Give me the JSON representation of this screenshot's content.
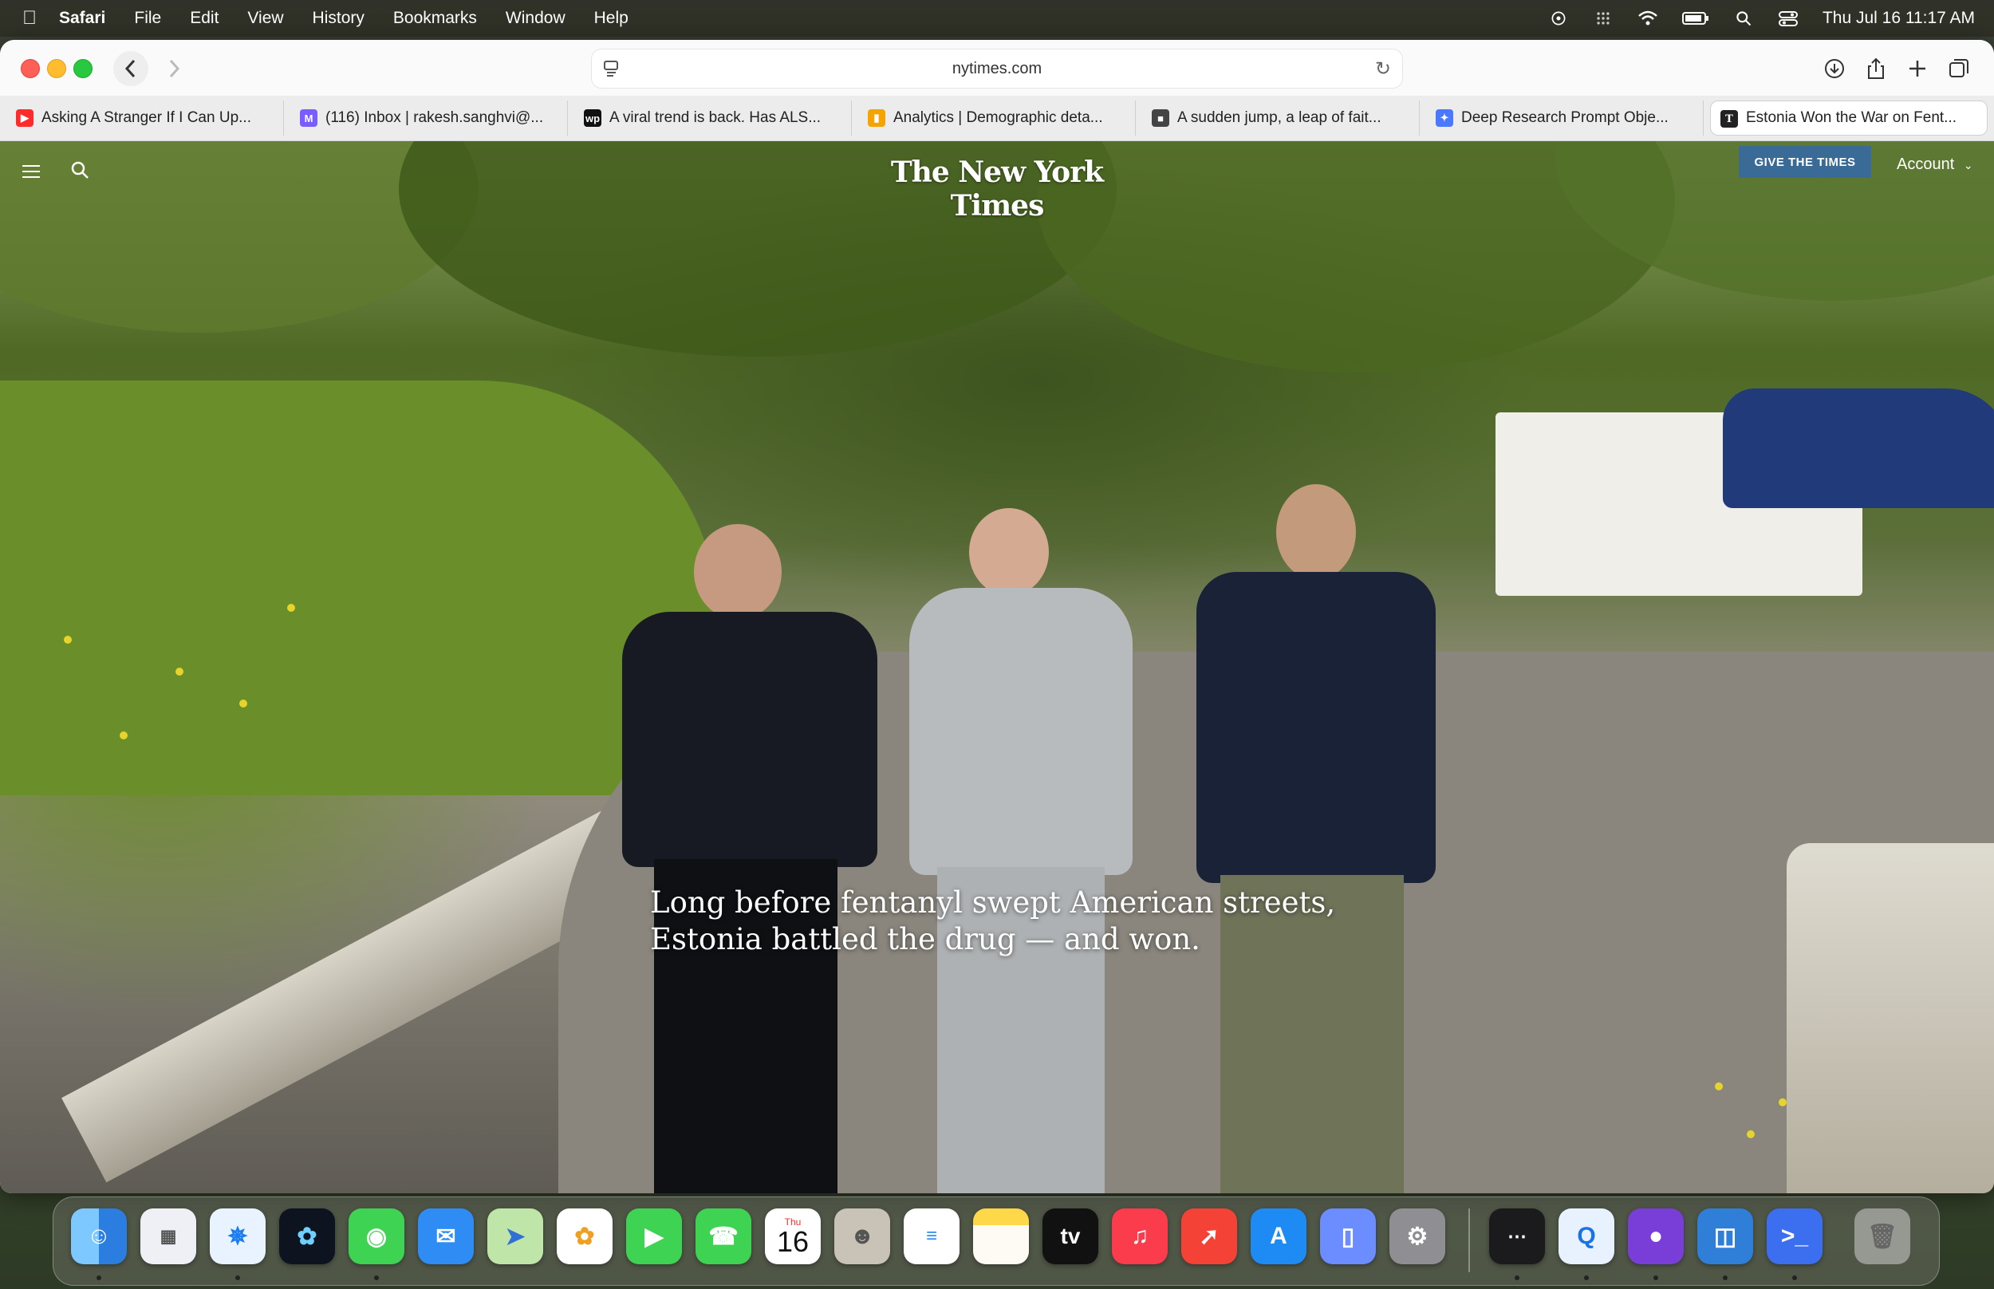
{
  "menubar": {
    "app": "Safari",
    "items": [
      "File",
      "Edit",
      "View",
      "History",
      "Bookmarks",
      "Window",
      "Help"
    ],
    "clock": "Thu Jul 16  11:17 AM"
  },
  "address": {
    "url": "nytimes.com"
  },
  "tabs": [
    {
      "title": "Asking A Stranger If I Can Up...",
      "fav_color": "#ff2b2b",
      "fav_glyph": "▶"
    },
    {
      "title": "(116) Inbox | rakesh.sanghvi@...",
      "fav_color": "#7b5cff",
      "fav_glyph": "M"
    },
    {
      "title": "A viral trend is back. Has ALS...",
      "fav_color": "#111111",
      "fav_glyph": "wp"
    },
    {
      "title": "Analytics | Demographic deta...",
      "fav_color": "#f4a300",
      "fav_glyph": "▮"
    },
    {
      "title": "A sudden jump, a leap of fait...",
      "fav_color": "#444444",
      "fav_glyph": "■"
    },
    {
      "title": "Deep Research Prompt Obje...",
      "fav_color": "#4a78ff",
      "fav_glyph": "✦"
    },
    {
      "title": "Estonia Won the War on Fent...",
      "fav_color": "#222222",
      "fav_glyph": "T"
    }
  ],
  "nyt": {
    "logo": "The New York Times",
    "give_button": "GIVE THE TIMES",
    "account": "Account",
    "headline": "Long before fentanyl swept American streets, Estonia battled the drug — and won."
  },
  "dock": {
    "calendar_month": "Thu",
    "calendar_day": "16",
    "tv_label": "tv"
  }
}
